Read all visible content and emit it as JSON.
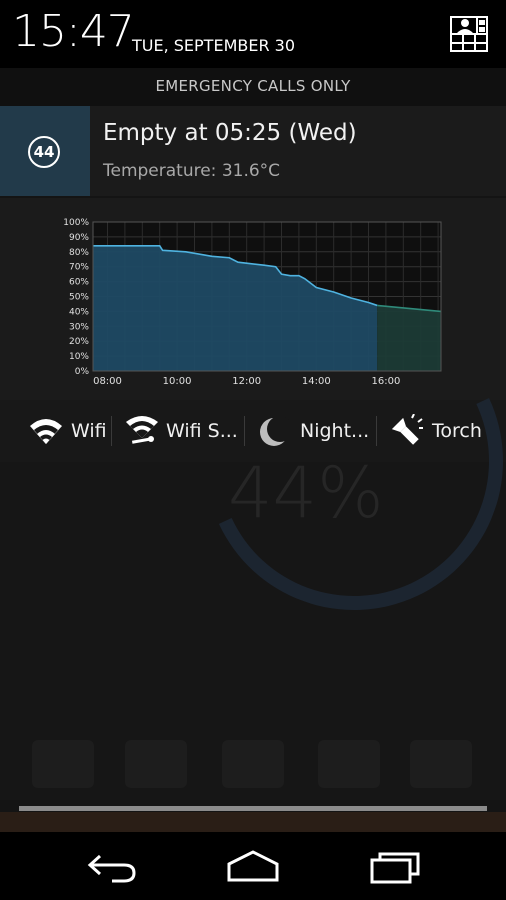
{
  "status_bar": {
    "time": "15:47",
    "date": "TUE, SEPTEMBER 30",
    "settings_icon": "quick-settings-icon"
  },
  "carrier": "EMERGENCY CALLS ONLY",
  "notification": {
    "badge": "44",
    "title": "Empty at 05:25 (Wed)",
    "text": "Temperature: 31.6°C",
    "accent_color": "#223a4a"
  },
  "chart_data": {
    "type": "area",
    "y_ticks": [
      "100%",
      "90%",
      "80%",
      "70%",
      "60%",
      "50%",
      "40%",
      "30%",
      "20%",
      "10%",
      "0%"
    ],
    "x_ticks": [
      "08:00",
      "10:00",
      "12:00",
      "14:00",
      "16:00"
    ],
    "ylim": [
      0,
      100
    ],
    "xlim": [
      "07:35",
      "17:35"
    ],
    "grid": true,
    "series": [
      {
        "color": "#4fb3e0",
        "points": [
          [
            "07:35",
            84
          ],
          [
            "09:30",
            84
          ],
          [
            "09:35",
            81
          ],
          [
            "10:15",
            80
          ],
          [
            "11:00",
            77
          ],
          [
            "11:30",
            76
          ],
          [
            "11:45",
            73
          ],
          [
            "12:30",
            71
          ],
          [
            "12:50",
            70
          ],
          [
            "13:00",
            65
          ],
          [
            "13:15",
            64
          ],
          [
            "13:30",
            64
          ],
          [
            "13:40",
            62
          ],
          [
            "14:00",
            56
          ],
          [
            "14:30",
            53
          ],
          [
            "15:00",
            49
          ],
          [
            "15:30",
            46
          ],
          [
            "15:45",
            44
          ]
        ]
      },
      {
        "color": "#2f8a7a",
        "points": [
          [
            "15:45",
            44
          ],
          [
            "17:35",
            40
          ]
        ]
      }
    ]
  },
  "toggles": [
    {
      "label": "Wifi",
      "icon": "wifi-icon"
    },
    {
      "label": "Wifi S...",
      "icon": "wifi-settings-icon"
    },
    {
      "label": "Night...",
      "icon": "moon-icon"
    },
    {
      "label": "Torch",
      "icon": "flashlight-icon"
    }
  ],
  "wallpaper": {
    "battery_text": "44%"
  },
  "navbar": {
    "back_icon": "back-icon",
    "home_icon": "home-icon",
    "recents_icon": "recents-icon"
  }
}
